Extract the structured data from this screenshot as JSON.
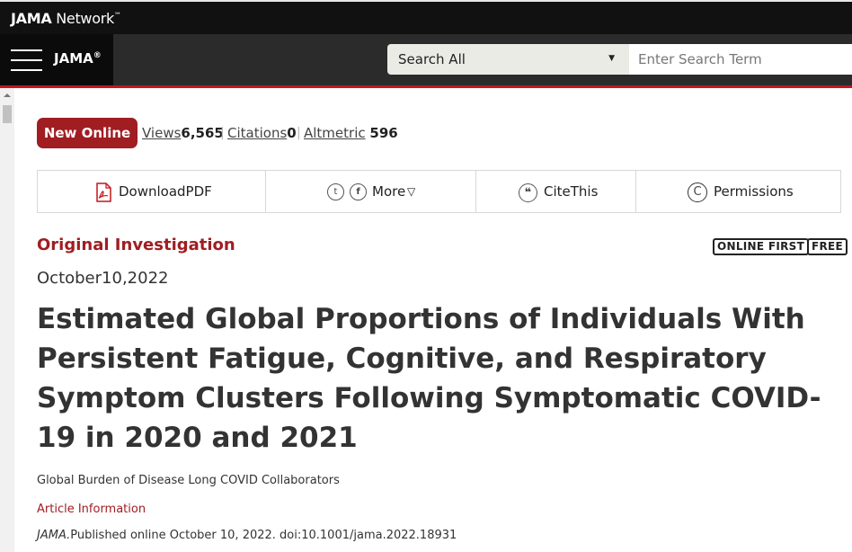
{
  "top_bar": {
    "network_name_bold": "JAMA",
    "network_name_rest": " Network",
    "trademark": "™"
  },
  "nav": {
    "brand": "JAMA",
    "brand_mark": "®",
    "search_scope": "Search All",
    "search_placeholder": "Enter Search Term"
  },
  "metrics": {
    "badge": "New Online",
    "views_label": "Views",
    "views_value": "6,565",
    "citations_label": "Citations",
    "citations_value": "0",
    "altmetric_label": "Altmetric",
    "altmetric_value": "596",
    "separator": "|"
  },
  "toolbar": {
    "download_label": "DownloadPDF",
    "twitter_icon": "twitter-icon",
    "facebook_icon": "facebook-icon",
    "more_label": "More",
    "more_caret": "▽",
    "cite_icon_glyph": "❝",
    "cite_label": "CiteThis",
    "permissions_icon_glyph": "C",
    "permissions_label": "Permissions"
  },
  "article": {
    "type": "Original Investigation",
    "badge_online_first": "ONLINE FIRST",
    "badge_free": "FREE",
    "date": "October10,2022",
    "title": "Estimated Global Proportions of Individuals With Persistent Fatigue, Cognitive, and Respiratory Symptom Clusters Following Symptomatic COVID-19 in 2020 and 2021",
    "authors": "Global Burden of Disease Long COVID Collaborators",
    "article_info_label": "Article Information",
    "journal": "JAMA.",
    "citation_rest": "Published online October 10, 2022. doi:10.1001/jama.2022.18931"
  },
  "colors": {
    "accent_red": "#a01d22",
    "nav_line_red": "#c4161c",
    "top_bar": "#111111",
    "nav_bar": "#2b2b2b"
  }
}
